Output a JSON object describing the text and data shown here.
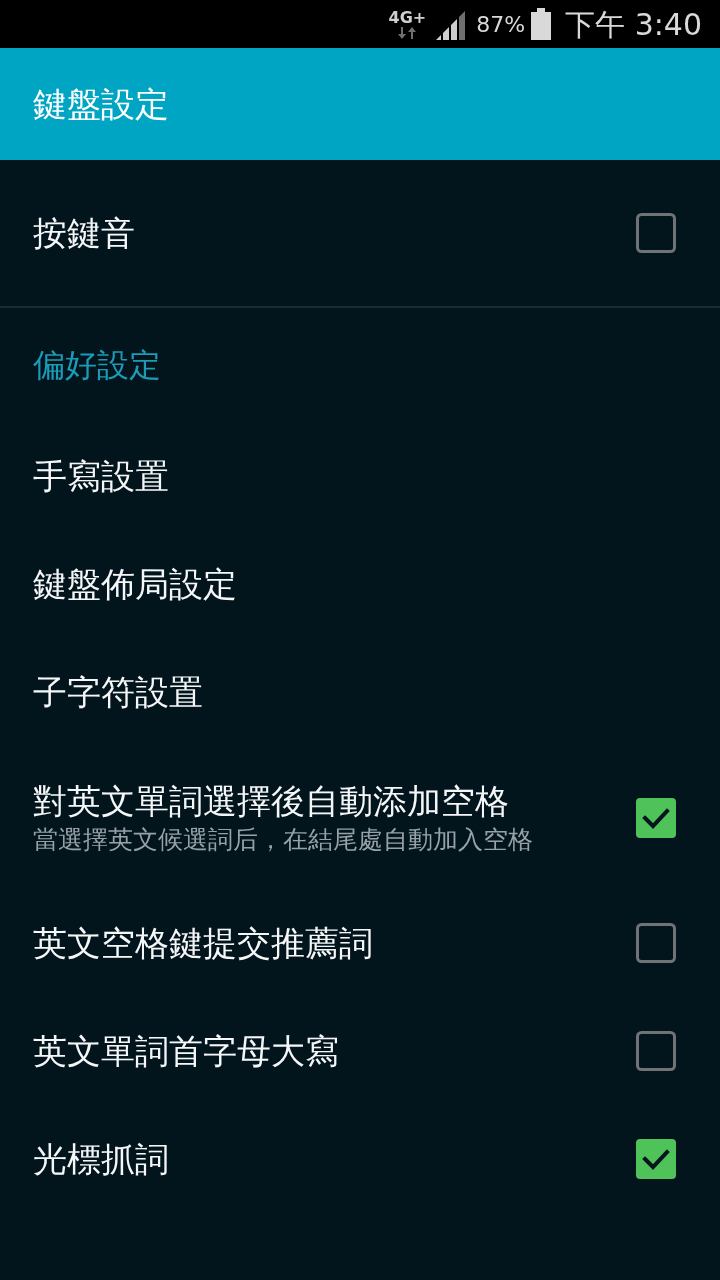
{
  "status_bar": {
    "network": "4G+",
    "battery_text": "87%",
    "time": "下午 3:40"
  },
  "app_bar": {
    "title": "鍵盤設定"
  },
  "sections": [
    {
      "items": [
        {
          "kind": "checkbox",
          "title": "按鍵音",
          "checked": false
        }
      ]
    },
    {
      "title": "偏好設定",
      "items": [
        {
          "kind": "link",
          "title": "手寫設置"
        },
        {
          "kind": "link",
          "title": "鍵盤佈局設定"
        },
        {
          "kind": "link",
          "title": "子字符設置"
        },
        {
          "kind": "checkbox",
          "title": "對英文單詞選擇後自動添加空格",
          "summary": "當選擇英文候選詞后，在結尾處自動加入空格",
          "checked": true
        },
        {
          "kind": "checkbox",
          "title": "英文空格鍵提交推薦詞",
          "checked": false
        },
        {
          "kind": "checkbox",
          "title": "英文單詞首字母大寫",
          "checked": false
        },
        {
          "kind": "checkbox",
          "title": "光標抓詞",
          "checked": true
        }
      ]
    }
  ]
}
